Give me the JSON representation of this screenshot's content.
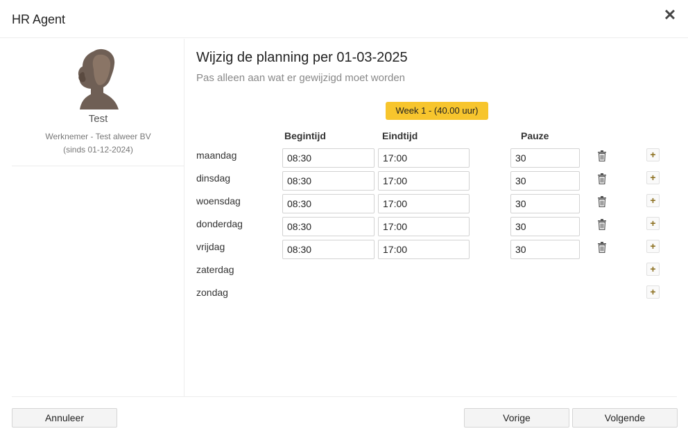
{
  "dialog": {
    "title": "HR Agent",
    "close_label": "✕"
  },
  "employee": {
    "name": "Test",
    "role": "Werknemer - Test alweer BV",
    "since": "(sinds 01-12-2024)"
  },
  "main": {
    "heading": "Wijzig de planning per 01-03-2025",
    "subheading": "Pas alleen aan wat er gewijzigd moet worden",
    "week_label": "Week 1 - (40.00 uur)"
  },
  "columns": {
    "start": "Begintijd",
    "end": "Eindtijd",
    "pause": "Pauze"
  },
  "days": [
    {
      "label": "maandag",
      "start": "08:30",
      "end": "17:00",
      "pause": "30"
    },
    {
      "label": "dinsdag",
      "start": "08:30",
      "end": "17:00",
      "pause": "30"
    },
    {
      "label": "woensdag",
      "start": "08:30",
      "end": "17:00",
      "pause": "30"
    },
    {
      "label": "donderdag",
      "start": "08:30",
      "end": "17:00",
      "pause": "30"
    },
    {
      "label": "vrijdag",
      "start": "08:30",
      "end": "17:00",
      "pause": "30"
    },
    {
      "label": "zaterdag"
    },
    {
      "label": "zondag"
    }
  ],
  "icons": {
    "add": "plus-icon",
    "delete": "trash-icon",
    "close": "close-icon",
    "avatar": "avatar-silhouette"
  },
  "footer": {
    "cancel": "Annuleer",
    "previous": "Vorige",
    "next": "Volgende"
  },
  "colors": {
    "accent": "#f7c52d",
    "plus": "#8a6d1b"
  }
}
